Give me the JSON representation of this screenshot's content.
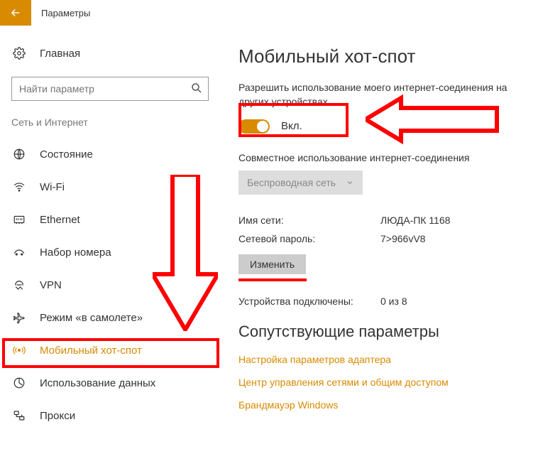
{
  "header": {
    "title": "Параметры"
  },
  "sidebar": {
    "home": "Главная",
    "search_placeholder": "Найти параметр",
    "category": "Сеть и Интернет",
    "items": [
      {
        "label": "Состояние"
      },
      {
        "label": "Wi-Fi"
      },
      {
        "label": "Ethernet"
      },
      {
        "label": "Набор номера"
      },
      {
        "label": "VPN"
      },
      {
        "label": "Режим «в самолете»"
      },
      {
        "label": "Мобильный хот-спот"
      },
      {
        "label": "Использование данных"
      },
      {
        "label": "Прокси"
      }
    ]
  },
  "content": {
    "title": "Мобильный хот-спот",
    "desc": "Разрешить использование моего интернет-соединения на других устройствах",
    "toggle_state": "Вкл.",
    "share_label": "Совместное использование интернет-соединения",
    "dropdown_value": "Беспроводная сеть",
    "network_name_label": "Имя сети:",
    "network_name_value": "ЛЮДА-ПК 1168",
    "password_label": "Сетевой пароль:",
    "password_value": "7>966vV8",
    "edit_button": "Изменить",
    "devices_label": "Устройства подключены:",
    "devices_value": "0 из 8",
    "related_title": "Сопутствующие параметры",
    "links": [
      "Настройка параметров адаптера",
      "Центр управления сетями и общим доступом",
      "Брандмауэр Windows"
    ]
  }
}
